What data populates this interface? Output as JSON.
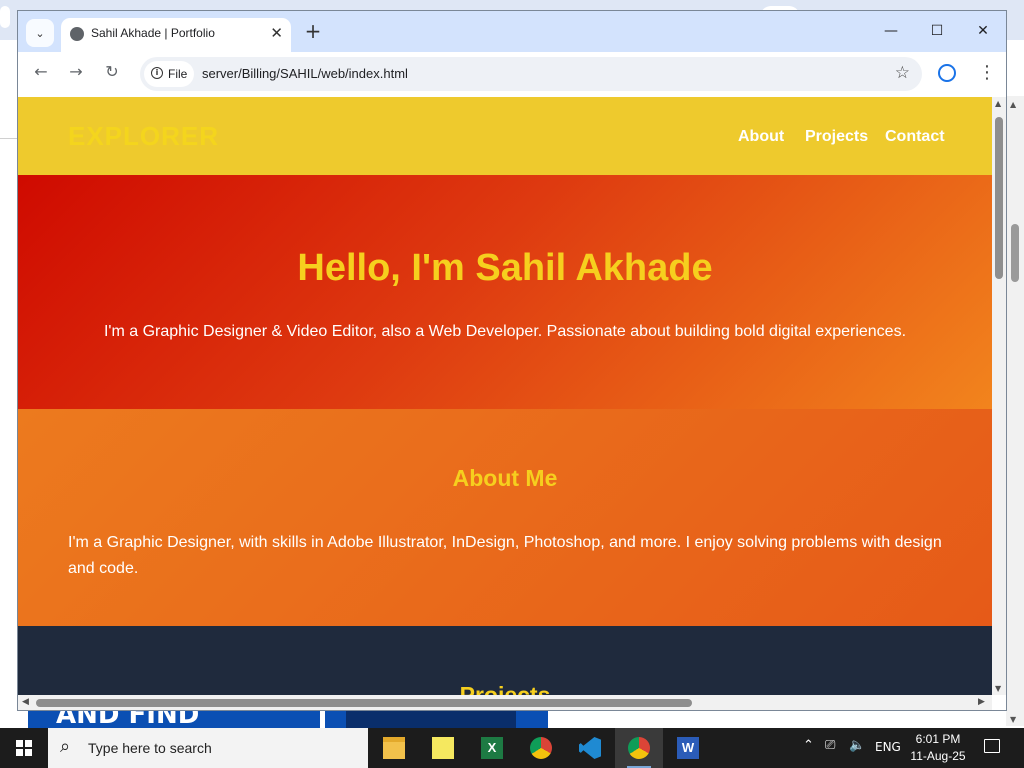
{
  "browser": {
    "tab_title": "Sahil Akhade | Portfolio",
    "tab_close": "✕",
    "new_tab": "+",
    "file_chip": "File",
    "url": "server/Billing/SAHIL/web/index.html",
    "controls": {
      "minimize": "—",
      "maximize": "☐",
      "close": "✕"
    },
    "nav": {
      "back": "←",
      "forward": "→",
      "reload": "↻"
    },
    "star": "☆",
    "menu": "⋮"
  },
  "site": {
    "brand": "EXPLORER",
    "nav_links": [
      "About",
      "Projects",
      "Contact"
    ],
    "hero_title": "Hello, I'm Sahil Akhade",
    "hero_subtitle": "I'm a Graphic Designer & Video Editor, also a Web Developer. Passionate about building bold digital experiences.",
    "about_title": "About Me",
    "about_text": "I'm a Graphic Designer, with skills in Adobe Illustrator, InDesign, Photoshop, and more. I enjoy solving problems with design and code.",
    "projects_title": "Projects"
  },
  "background_window": {
    "banner_text": "AND FIND"
  },
  "taskbar": {
    "search_placeholder": "Type here to search",
    "apps": [
      "file-explorer",
      "sticky-app",
      "excel",
      "chrome",
      "vs-code",
      "chrome-active",
      "word"
    ],
    "tray_language": "ENG",
    "time": "6:01 PM",
    "date": "11-Aug-25"
  },
  "colors": {
    "nav_bg": "#eeca2d",
    "accent_yellow": "#f6cf1e",
    "hero_red": "#cf0a00",
    "hero_orange": "#f2841d",
    "projects_bg": "#1f2a3d"
  }
}
